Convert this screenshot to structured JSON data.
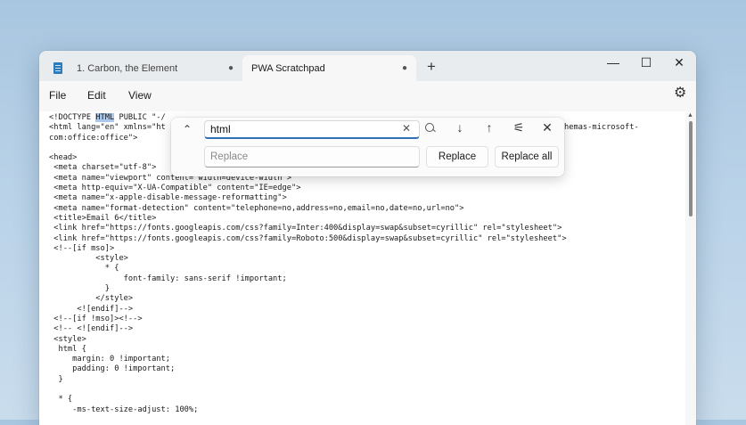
{
  "tabs": [
    {
      "label": "1. Carbon, the Element",
      "modified_dot": "●"
    },
    {
      "label": "PWA Scratchpad",
      "modified_dot": "●"
    }
  ],
  "new_tab_label": "+",
  "window_controls": {
    "minimize": "—",
    "maximize": "☐",
    "close": "✕"
  },
  "menu": {
    "file": "File",
    "edit": "Edit",
    "view": "View"
  },
  "settings_icon": "⚙",
  "find": {
    "query": "html",
    "replace_placeholder": "Replace",
    "replace_label": "Replace",
    "replace_all_label": "Replace all",
    "collapse_icon": "⌃",
    "clear_icon": "✕",
    "next_icon": "↓",
    "prev_icon": "↑",
    "options_icon": "⚟",
    "close_icon": "✕"
  },
  "editor": {
    "line1_pre": "<!DOCTYPE ",
    "line1_match": "HTML",
    "line1_post": " PUBLIC \"-/",
    "line2": "<html lang=\"en\" xmlns=\"ht",
    "line2_end": "hemas-microsoft-",
    "line3": "com:office:office\">",
    "body": "\n<head>\n <meta charset=\"utf-8\">\n <meta name=\"viewport\" content=\"width=device-width\">\n <meta http-equiv=\"X-UA-Compatible\" content=\"IE=edge\">\n <meta name=\"x-apple-disable-message-reformatting\">\n <meta name=\"format-detection\" content=\"telephone=no,address=no,email=no,date=no,url=no\">\n <title>Email 6</title>\n <link href=\"https://fonts.googleapis.com/css?family=Inter:400&display=swap&subset=cyrillic\" rel=\"stylesheet\">\n <link href=\"https://fonts.googleapis.com/css?family=Roboto:500&display=swap&subset=cyrillic\" rel=\"stylesheet\">\n <!--[if mso]>\n          <style>\n            * {\n                font-family: sans-serif !important;\n            }\n          </style>\n      <![endif]-->\n <!--[if !mso]><!-->\n <!-- <![endif]-->\n <style>\n  html {\n     margin: 0 !important;\n     padding: 0 !important;\n  }\n\n  * {\n     -ms-text-size-adjust: 100%;"
  }
}
